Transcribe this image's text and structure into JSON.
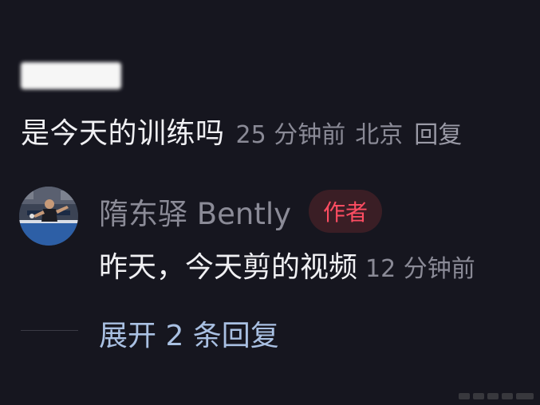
{
  "comment": {
    "text": "是今天的训练吗",
    "time": "25 分钟前",
    "location": "北京",
    "reply_label": "回复"
  },
  "reply": {
    "author": "隋东驿 Bently",
    "badge": "作者",
    "text": "昨天，今天剪的视频",
    "time": "12 分钟前"
  },
  "expand_label": "展开 2 条回复",
  "colors": {
    "background": "#16161f",
    "badge_text": "#ff4d62",
    "badge_bg": "#3a1e25",
    "link": "#a9c0e2"
  }
}
